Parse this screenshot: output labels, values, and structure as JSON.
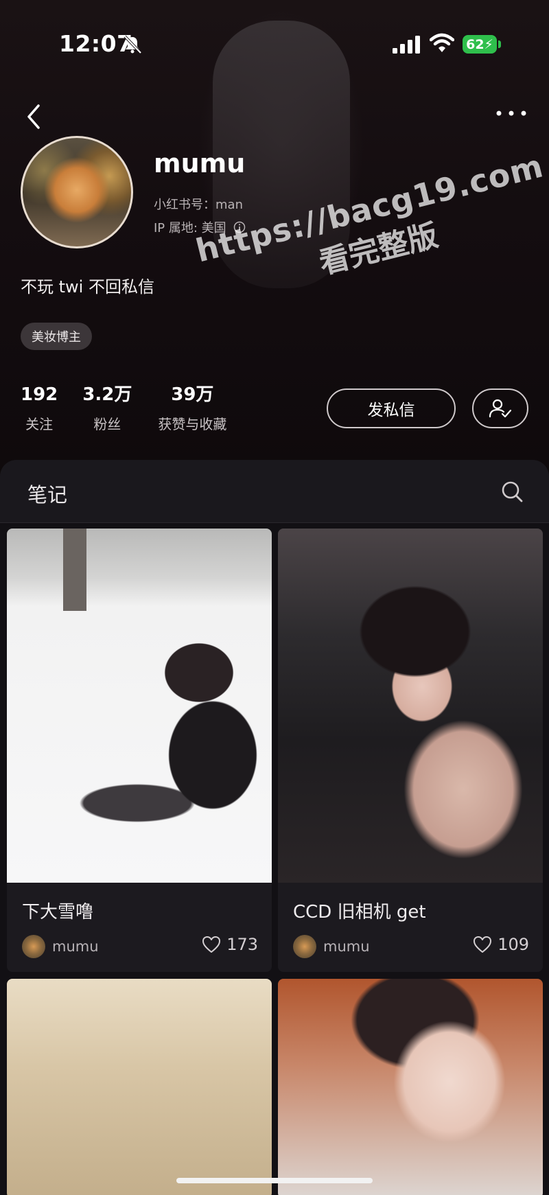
{
  "status_bar": {
    "time": "12:07",
    "battery": "62"
  },
  "profile": {
    "username": "mumu",
    "redbook_id": "小红书号：man",
    "ip_location": "IP 属地: 美国",
    "bio": "不玩 twi 不回私信",
    "tag": "美妆博主",
    "stats": [
      {
        "value": "192",
        "label": "关注"
      },
      {
        "value": "3.2万",
        "label": "粉丝"
      },
      {
        "value": "39万",
        "label": "获赞与收藏"
      }
    ],
    "message_button": "发私信"
  },
  "watermark": {
    "line1": "https://bacg19.com",
    "line2": "看完整版"
  },
  "notes": {
    "tab_label": "笔记",
    "cards": [
      {
        "title": "下大雪噜",
        "author": "mumu",
        "likes": "173"
      },
      {
        "title": "CCD 旧相机 get",
        "author": "mumu",
        "likes": "109"
      }
    ]
  },
  "colors": {
    "background": "#0e0a0b",
    "panel": "#121014",
    "battery_green": "#2fbf4c"
  },
  "icons": [
    "bell-slash-icon",
    "signal-icon",
    "wifi-icon",
    "back-icon",
    "more-icon",
    "info-icon",
    "follow-status-icon",
    "search-icon",
    "heart-icon"
  ]
}
